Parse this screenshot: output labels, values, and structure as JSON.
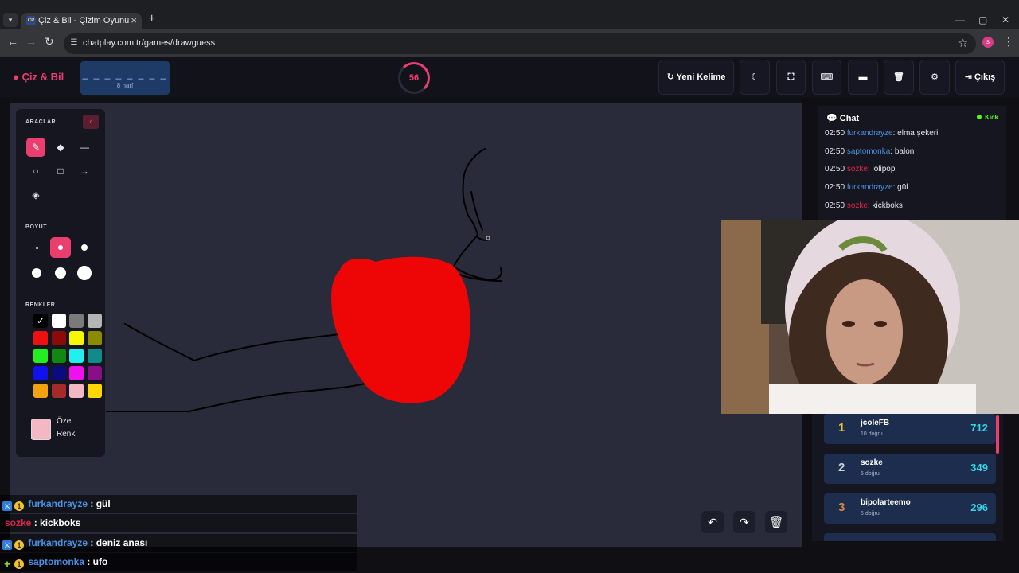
{
  "browser": {
    "tab_title": "Çiz & Bil - Çizim Oyunu",
    "tab_favicon": "CP",
    "url": "chatplay.com.tr/games/drawguess",
    "profile_initial": "s"
  },
  "header": {
    "brand": "Çiz & Bil",
    "word_dashes": "_ _ _ _ _ _ _ _",
    "word_length": "8 harf",
    "timer": "56",
    "new_word_label": "Yeni Kelime",
    "exit_label": "Çıkış"
  },
  "tools": {
    "section_tools": "ARAÇLAR",
    "section_size": "BOYUT",
    "section_colors": "RENKLER",
    "custom_color_label": "Özel Renk",
    "active_tool": "pencil",
    "active_size_index": 1,
    "colors": [
      "#000000",
      "#ffffff",
      "#7a7a7a",
      "#b5b5b5",
      "#ee1111",
      "#8b0a0a",
      "#f7f700",
      "#8b8b00",
      "#22ee22",
      "#118811",
      "#22f0f0",
      "#118a8a",
      "#1111ee",
      "#0b0b80",
      "#ee11ee",
      "#880f88",
      "#f2a20e",
      "#a52a2a",
      "#f4b8c5",
      "#ffd700"
    ],
    "custom_color": "#f4b8c5"
  },
  "chat": {
    "title": "Chat",
    "platform": "Kick",
    "messages": [
      {
        "time": "02:50",
        "user": "furkandrayze",
        "color": "#4a90e2",
        "text": ": elma şekeri"
      },
      {
        "time": "02:50",
        "user": "saptomonka",
        "color": "#4a90e2",
        "text": ": balon"
      },
      {
        "time": "02:50",
        "user": "sozke",
        "color": "#e0244a",
        "text": ": lolipop"
      },
      {
        "time": "02:50",
        "user": "furkandrayze",
        "color": "#4a90e2",
        "text": ": gül"
      },
      {
        "time": "02:50",
        "user": "sozke",
        "color": "#e0244a",
        "text": ": kickboks"
      }
    ]
  },
  "leaderboard": [
    {
      "rank": "1",
      "name": "jcoleFB",
      "sub": "10 doğru",
      "score": "712",
      "rank_color": "#f2c12e"
    },
    {
      "rank": "2",
      "name": "sozke",
      "sub": "5 doğru",
      "score": "349",
      "rank_color": "#c8ccd6"
    },
    {
      "rank": "3",
      "name": "bipolarteemo",
      "sub": "5 doğru",
      "score": "296",
      "rank_color": "#d08a4a"
    }
  ],
  "stream_chat": [
    {
      "user": "furkandrayze",
      "color": "#4a90e2",
      "text": " : gül",
      "badges": true
    },
    {
      "user": "sozke",
      "color": "#e0244a",
      "text": " : kickboks",
      "badges": false
    },
    {
      "user": "furkandrayze",
      "color": "#4a90e2",
      "text": " : deniz anası",
      "badges": true
    },
    {
      "user": "saptomonka",
      "color": "#4a90e2",
      "text": " : ufo",
      "badges": true
    }
  ]
}
